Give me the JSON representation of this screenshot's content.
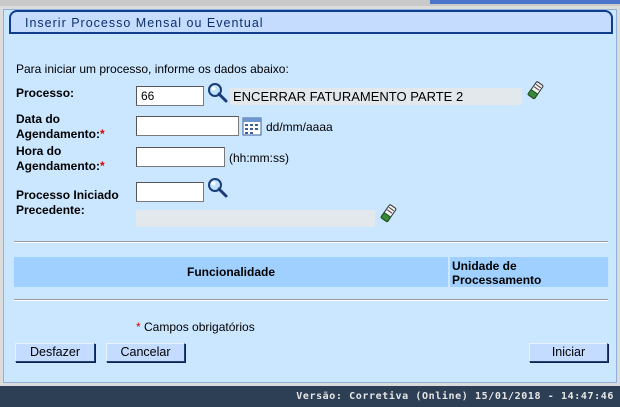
{
  "page": {
    "title": "Inserir Processo Mensal ou Eventual",
    "intro": "Para iniciar um processo, informe os dados abaixo:"
  },
  "form": {
    "processo": {
      "label": "Processo:",
      "value": "66",
      "description": "ENCERRAR FATURAMENTO PARTE 2"
    },
    "data_agendamento": {
      "label_line1": "Data do",
      "label_line2": "Agendamento:",
      "required_mark": "*",
      "value": "",
      "hint": "dd/mm/aaaa"
    },
    "hora_agendamento": {
      "label_line1": "Hora do",
      "label_line2": "Agendamento:",
      "required_mark": "*",
      "value": "",
      "hint": "(hh:mm:ss)"
    },
    "processo_precedente": {
      "label_line1": "Processo Iniciado",
      "label_line2": "Precedente:",
      "value": "",
      "description": ""
    }
  },
  "table": {
    "columns": [
      "Funcionalidade",
      "Unidade de Processamento"
    ],
    "rows": []
  },
  "required_note": {
    "mark": "*",
    "text": " Campos obrigatórios"
  },
  "buttons": {
    "desfazer": "Desfazer",
    "cancelar": "Cancelar",
    "iniciar": "Iniciar"
  },
  "footer": {
    "version": "Versão: Corretiva (Online) 15/01/2018 - 14:47:46"
  },
  "colors": {
    "panel": "#cbe6ff",
    "title_border": "#0e3d8c",
    "table_header": "#9fd0ff",
    "footer_bg": "#2c3f55",
    "required": "#e00000"
  },
  "icons": [
    "magnifier-icon",
    "eraser-icon",
    "calendar-icon"
  ]
}
